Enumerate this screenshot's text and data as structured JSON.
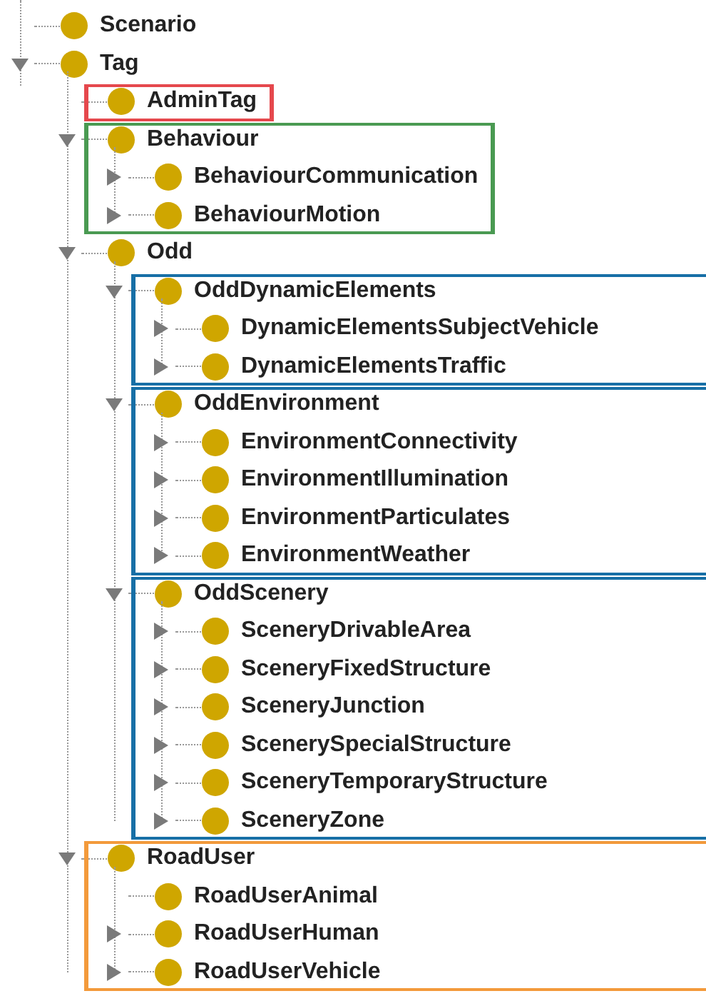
{
  "tree": [
    {
      "label": "Scenario"
    },
    {
      "label": "Tag",
      "expanded": true,
      "children": [
        {
          "label": "AdminTag",
          "frame": {
            "color": "#e5484d",
            "cut_at_edge": false
          }
        },
        {
          "label": "Behaviour",
          "expanded": true,
          "frame": {
            "color": "#4a9a52",
            "cut_at_edge": false
          },
          "children": [
            {
              "label": "BehaviourCommunication",
              "expanded": false
            },
            {
              "label": "BehaviourMotion",
              "expanded": false
            }
          ]
        },
        {
          "label": "Odd",
          "expanded": true,
          "children": [
            {
              "label": "OddDynamicElements",
              "expanded": true,
              "frame": {
                "color": "#176fa6",
                "cut_at_edge": true
              },
              "children": [
                {
                  "label": "DynamicElementsSubjectVehicle",
                  "expanded": false
                },
                {
                  "label": "DynamicElementsTraffic",
                  "expanded": false
                }
              ]
            },
            {
              "label": "OddEnvironment",
              "expanded": true,
              "frame": {
                "color": "#176fa6",
                "cut_at_edge": true
              },
              "children": [
                {
                  "label": "EnvironmentConnectivity",
                  "expanded": false
                },
                {
                  "label": "EnvironmentIllumination",
                  "expanded": false
                },
                {
                  "label": "EnvironmentParticulates",
                  "expanded": false
                },
                {
                  "label": "EnvironmentWeather",
                  "expanded": false
                }
              ]
            },
            {
              "label": "OddScenery",
              "expanded": true,
              "frame": {
                "color": "#176fa6",
                "cut_at_edge": true
              },
              "children": [
                {
                  "label": "SceneryDrivableArea",
                  "expanded": false
                },
                {
                  "label": "SceneryFixedStructure",
                  "expanded": false
                },
                {
                  "label": "SceneryJunction",
                  "expanded": false
                },
                {
                  "label": "ScenerySpecialStructure",
                  "expanded": false
                },
                {
                  "label": "SceneryTemporaryStructure",
                  "expanded": false
                },
                {
                  "label": "SceneryZone",
                  "expanded": false
                }
              ]
            }
          ]
        },
        {
          "label": "RoadUser",
          "expanded": true,
          "frame": {
            "color": "#f39a3b",
            "cut_at_edge": true
          },
          "children": [
            {
              "label": "RoadUserAnimal"
            },
            {
              "label": "RoadUserHuman",
              "expanded": false
            },
            {
              "label": "RoadUserVehicle",
              "expanded": false
            }
          ]
        }
      ]
    }
  ]
}
